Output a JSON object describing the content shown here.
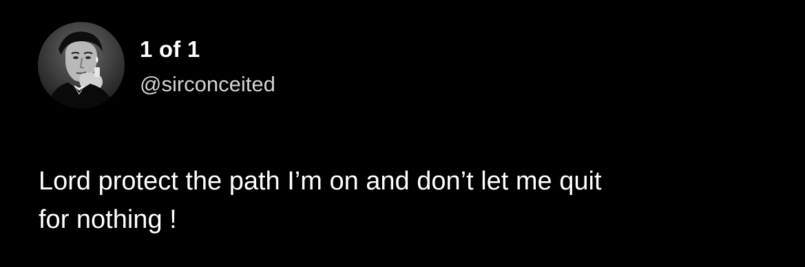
{
  "profile": {
    "display_name": "1 of 1",
    "handle": "@sirconceited",
    "avatar_icon": "profile-photo-avatar"
  },
  "tweet": {
    "text": "Lord protect the path I’m on and don’t let me quit\nfor nothing !"
  },
  "colors": {
    "background": "#000000",
    "primary_text": "#ffffff",
    "secondary_text": "#d3d3d3"
  }
}
